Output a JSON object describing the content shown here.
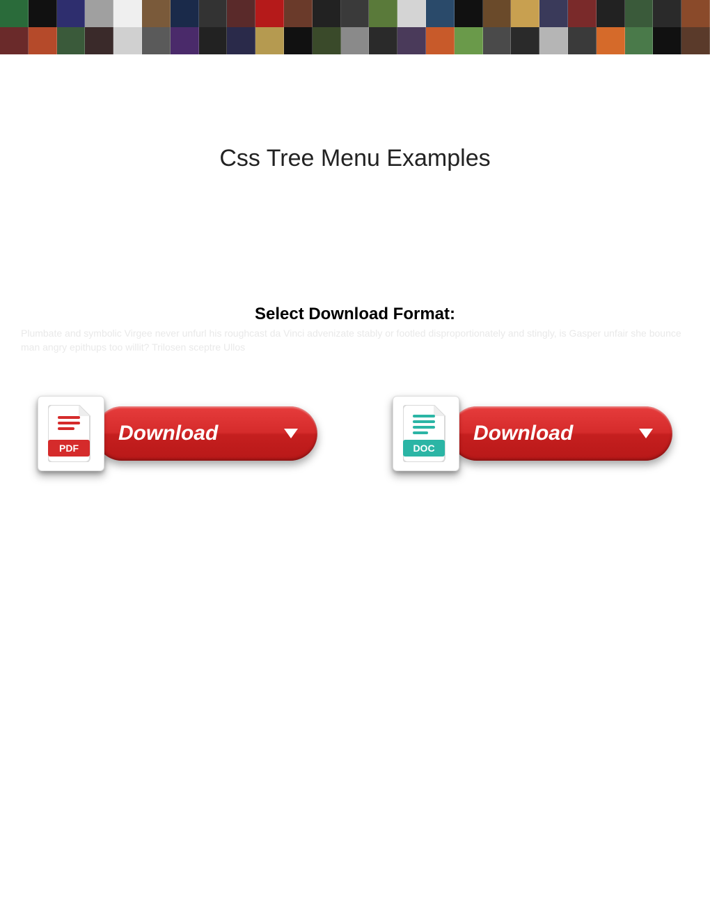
{
  "title": "Css Tree Menu Examples",
  "format_heading": "Select Download Format:",
  "faint_text": "Plumbate and symbolic Virgee never unfurl his roughcast da Vinci advenizate stably or footled disproportionately and stingly, is Gasper unfair she bounce man angry epithups too willit? Trilosen sceptre Ullos",
  "buttons": {
    "pdf": {
      "label": "Download",
      "badge": "PDF"
    },
    "doc": {
      "label": "Download",
      "badge": "DOC"
    }
  },
  "banner_colors_row1": [
    "#2a6b3a",
    "#111",
    "#2e2e6e",
    "#a0a0a0",
    "#efefef",
    "#7a5a3a",
    "#1a2a4a",
    "#333",
    "#5a2a2a",
    "#b51a1a",
    "#6a3a2a",
    "#222",
    "#3a3a3a",
    "#5a7a3a",
    "#d4d4d4",
    "#2a4a6a",
    "#111",
    "#6a4a2a",
    "#c8a050",
    "#3a3a5a",
    "#7a2a2a",
    "#222",
    "#3a5a3a",
    "#2a2a2a",
    "#8a4a2a"
  ],
  "banner_colors_row2": [
    "#6a2a2a",
    "#b54a2a",
    "#3a5a3a",
    "#3a2a2a",
    "#d0d0d0",
    "#5a5a5a",
    "#4a2a6a",
    "#222",
    "#2a2a4a",
    "#b59a50",
    "#111",
    "#3a4a2a",
    "#8a8a8a",
    "#2a2a2a",
    "#4a3a5a",
    "#c85a2a",
    "#6a9a4a",
    "#4a4a4a",
    "#2a2a2a",
    "#b5b5b5",
    "#3a3a3a",
    "#d56a2a",
    "#4a7a4a",
    "#111",
    "#5a3a2a"
  ]
}
